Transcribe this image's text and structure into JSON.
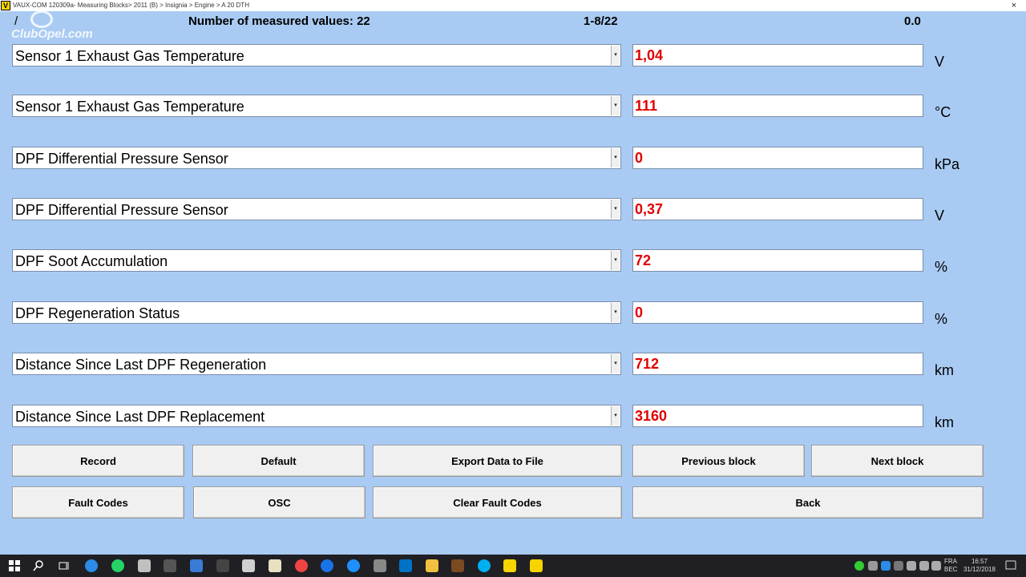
{
  "window": {
    "title": "VAUX-COM 120309a- Measuring Blocks> 2011 (B) > Insignia > Engine > A 20 DTH",
    "logo_letter": "V",
    "close_glyph": "×"
  },
  "header": {
    "slash": "/",
    "measured_count": "Number of measured values: 22",
    "range": "1-8/22",
    "value": "0.0",
    "watermark": "ClubOpel.com"
  },
  "rows": [
    {
      "label": "Sensor 1 Exhaust Gas Temperature",
      "value": "1,04",
      "unit": "V"
    },
    {
      "label": "Sensor 1 Exhaust Gas Temperature",
      "value": "111",
      "unit": "°C"
    },
    {
      "label": "DPF Differential Pressure Sensor",
      "value": "0",
      "unit": "kPa"
    },
    {
      "label": "DPF Differential Pressure Sensor",
      "value": "0,37",
      "unit": "V"
    },
    {
      "label": "DPF Soot Accumulation",
      "value": "72",
      "unit": "%"
    },
    {
      "label": "DPF Regeneration Status",
      "value": "0",
      "unit": "%"
    },
    {
      "label": "Distance Since Last DPF Regeneration",
      "value": "712",
      "unit": "km"
    },
    {
      "label": "Distance Since Last DPF Replacement",
      "value": "3160",
      "unit": "km"
    }
  ],
  "dropdown_arrow": "▾",
  "buttons": {
    "record": "Record",
    "default": "Default",
    "export": "Export Data to File",
    "previous": "Previous block",
    "next": "Next block",
    "fault_codes": "Fault Codes",
    "osc": "OSC",
    "clear_fault_codes": "Clear Fault Codes",
    "back": "Back"
  },
  "taskbar": {
    "language_top": "FRA",
    "language_bottom": "BEC",
    "time": "16:57",
    "date": "31/12/2018"
  },
  "colors": {
    "background": "#a9cbf3",
    "value_text": "#e00000",
    "taskbar": "#1f1f24"
  }
}
